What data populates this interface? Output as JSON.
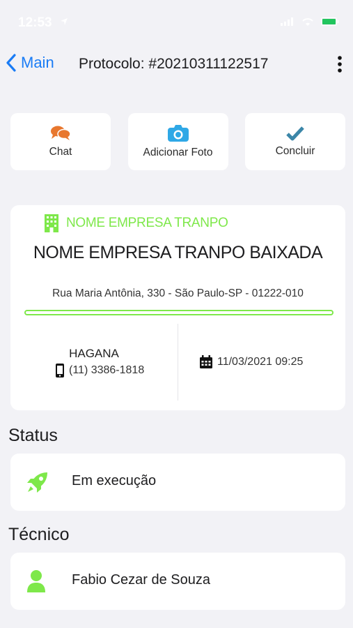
{
  "status_bar": {
    "time": "12:53"
  },
  "nav": {
    "back_label": "Main",
    "title": "Protocolo: #20210311122517"
  },
  "actions": [
    {
      "label": "Chat",
      "icon": "chat-icon"
    },
    {
      "label": "Adicionar Foto",
      "icon": "camera-icon"
    },
    {
      "label": "Concluir",
      "icon": "checkmark-icon"
    }
  ],
  "company": {
    "tag": "NOME EMPRESA  TRANPO",
    "name": "NOME EMPRESA TRANPO BAIXADA",
    "address": "Rua Maria Antônia, 330 - São Paulo-SP - 01222-010",
    "contact_name": "HAGANA",
    "phone": "(11) 3386-1818",
    "datetime": "11/03/2021 09:25"
  },
  "status_section": {
    "title": "Status",
    "value": "Em execução"
  },
  "technician_section": {
    "title": "Técnico",
    "value": "Fabio Cezar de Souza"
  },
  "colors": {
    "accent_blue": "#1a7cf5",
    "accent_green": "#7ee84a",
    "chat_orange": "#e8772e",
    "camera_blue": "#2fa8e6",
    "check_teal": "#3b86a8"
  }
}
